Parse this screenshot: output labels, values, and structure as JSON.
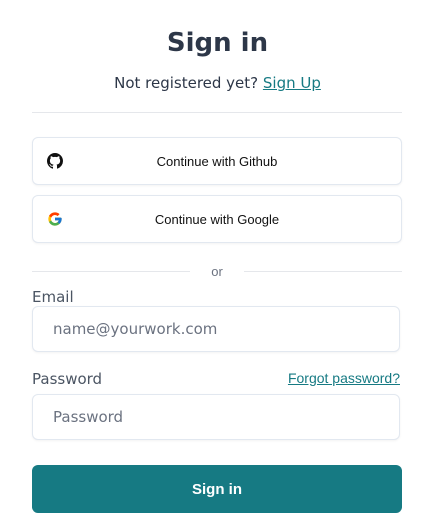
{
  "header": {
    "title": "Sign in",
    "subtitle_prefix": "Not registered yet?",
    "signup_link": "Sign Up"
  },
  "social": {
    "github_label": "Continue with Github",
    "github_icon": "github-icon",
    "google_label": "Continue with Google",
    "google_icon": "google-icon"
  },
  "separator": {
    "text": "or"
  },
  "form": {
    "email_label": "Email",
    "email_placeholder": "name@yourwork.com",
    "email_value": "",
    "password_label": "Password",
    "password_placeholder": "Password",
    "password_value": "",
    "forgot_link": "Forgot password?",
    "submit_label": "Sign in"
  },
  "colors": {
    "accent": "#167a83",
    "text": "#2d3748",
    "border": "#e2e8f0"
  }
}
